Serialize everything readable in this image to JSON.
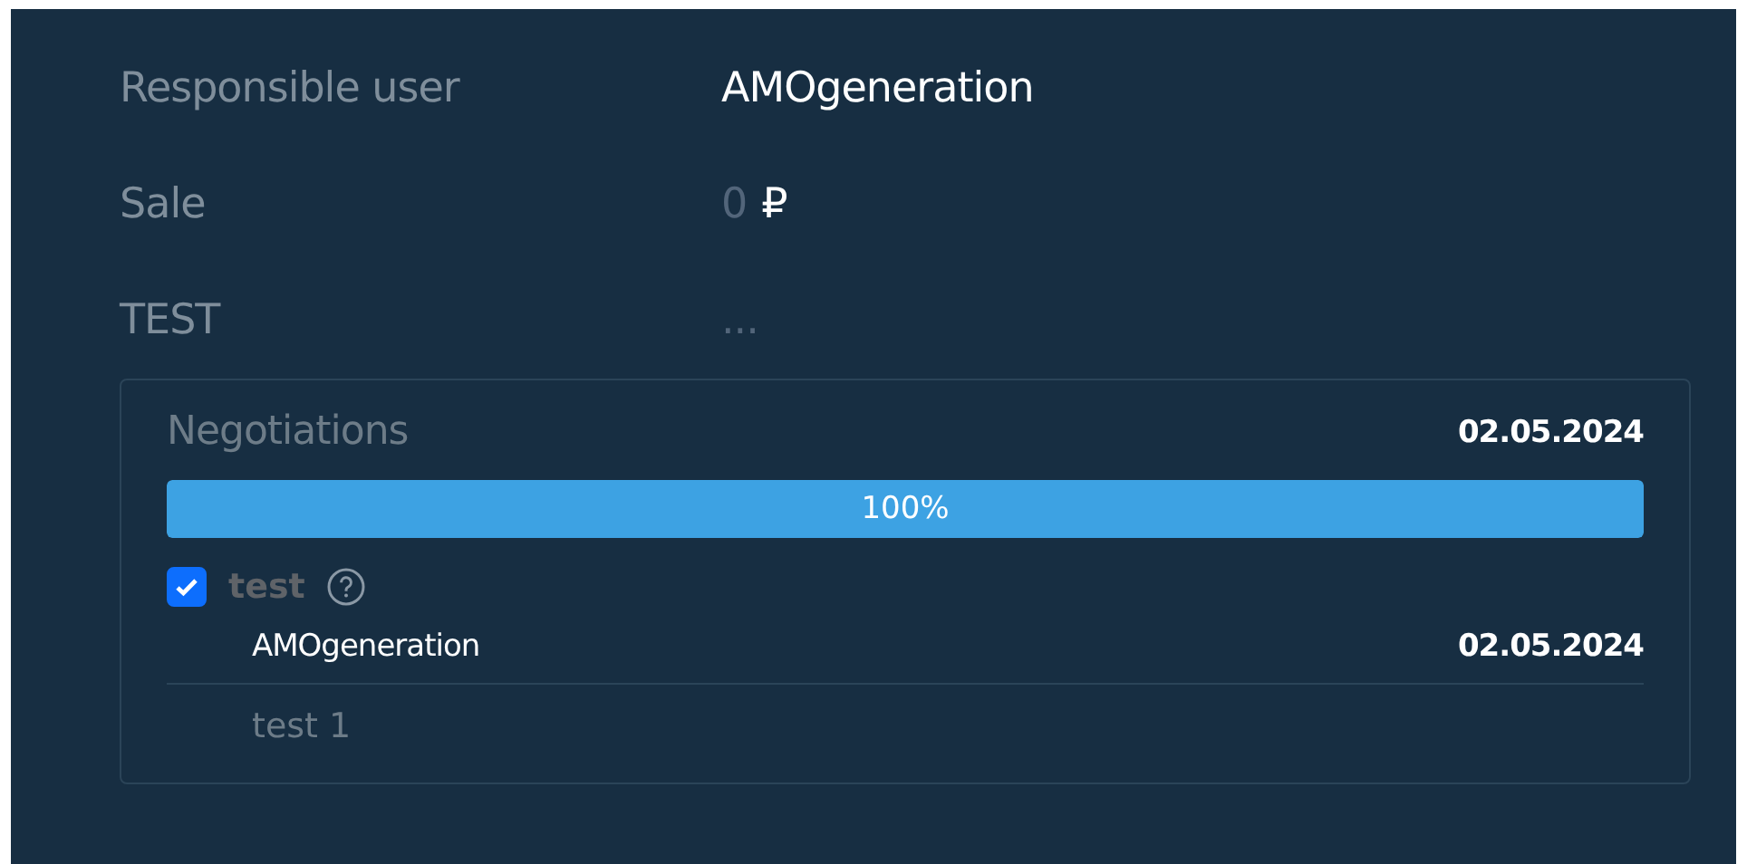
{
  "fields": [
    {
      "label": "Responsible user",
      "value": "AMOgeneration",
      "kind": "text"
    },
    {
      "label": "Sale",
      "value": "0",
      "currency": "₽",
      "kind": "money"
    },
    {
      "label": "TEST",
      "value": "...",
      "kind": "empty"
    }
  ],
  "stage": {
    "title": "Negotiations",
    "date": "02.05.2024",
    "level": 1,
    "reading": "100%",
    "task": {
      "label": "test",
      "checked": true,
      "author": "AMOgeneration",
      "date": "02.05.2024",
      "text": "test 1"
    }
  }
}
